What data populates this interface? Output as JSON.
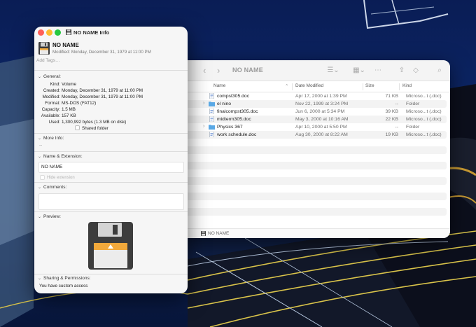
{
  "info_window": {
    "title": "NO NAME Info",
    "name": "NO NAME",
    "modified": "Modified: Monday, December 31, 1979 at 11:00 PM",
    "tags_placeholder": "Add Tags…",
    "general": {
      "header": "General:",
      "rows": [
        {
          "key": "Kind:",
          "value": "Volume"
        },
        {
          "key": "Created:",
          "value": "Monday, December 31, 1979 at 11:00 PM"
        },
        {
          "key": "Modified:",
          "value": "Monday, December 31, 1979 at 11:00 PM"
        },
        {
          "key": "Format:",
          "value": "MS-DOS (FAT12)"
        },
        {
          "key": "Capacity:",
          "value": "1.5 MB"
        },
        {
          "key": "Available:",
          "value": "157 KB"
        },
        {
          "key": "Used:",
          "value": "1,300,992 bytes (1.3 MB on disk)"
        }
      ],
      "shared_folder_label": "Shared folder"
    },
    "more_info": {
      "header": "More Info:",
      "value": "--"
    },
    "name_extension": {
      "header": "Name & Extension:",
      "value": "NO NAME",
      "hide_label": "Hide extension"
    },
    "comments": {
      "header": "Comments:"
    },
    "preview": {
      "header": "Preview:"
    },
    "sharing": {
      "header": "Sharing & Permissions:",
      "value": "You have custom access"
    }
  },
  "finder": {
    "title": "NO NAME",
    "columns": {
      "name": "Name",
      "date": "Date Modified",
      "size": "Size",
      "kind": "Kind"
    },
    "files": [
      {
        "name": "compst305.doc",
        "date": "Apr 17, 2000 at 1:39 PM",
        "size": "71 KB",
        "kind": "Microso...t (.doc)",
        "type": "doc",
        "expandable": false
      },
      {
        "name": "el nino",
        "date": "Nov 22, 1999 at 3:24 PM",
        "size": "--",
        "kind": "Folder",
        "type": "folder",
        "expandable": true
      },
      {
        "name": "finalcompst305.doc",
        "date": "Jun 6, 2000 at 5:34 PM",
        "size": "39 KB",
        "kind": "Microso...t (.doc)",
        "type": "doc",
        "expandable": false
      },
      {
        "name": "midterm305.doc",
        "date": "May 3, 2000 at 10:16 AM",
        "size": "22 KB",
        "kind": "Microso...t (.doc)",
        "type": "doc",
        "expandable": false
      },
      {
        "name": "Physics 367",
        "date": "Apr 10, 2000 at 5:50 PM",
        "size": "--",
        "kind": "Folder",
        "type": "folder",
        "expandable": true
      },
      {
        "name": "work schedule.doc",
        "date": "Aug 30, 2000 at 8:22 AM",
        "size": "19 KB",
        "kind": "Microso...t (.doc)",
        "type": "doc",
        "expandable": false
      }
    ],
    "footer": "NO NAME"
  },
  "icons": [
    "back-icon",
    "forward-icon",
    "list-view-icon",
    "grid-view-icon",
    "more-icon",
    "share-icon",
    "tag-icon",
    "search-icon",
    "floppy-disk-icon",
    "folder-icon",
    "document-icon",
    "chevron-down-icon",
    "chevron-right-icon"
  ],
  "colors": {
    "close": "#ff5f57",
    "minimize": "#febc2e",
    "zoom": "#28c840",
    "folder": "#5aa9e6",
    "floppy_label": "#f2a93b",
    "desktop": "#0b1a3c"
  }
}
